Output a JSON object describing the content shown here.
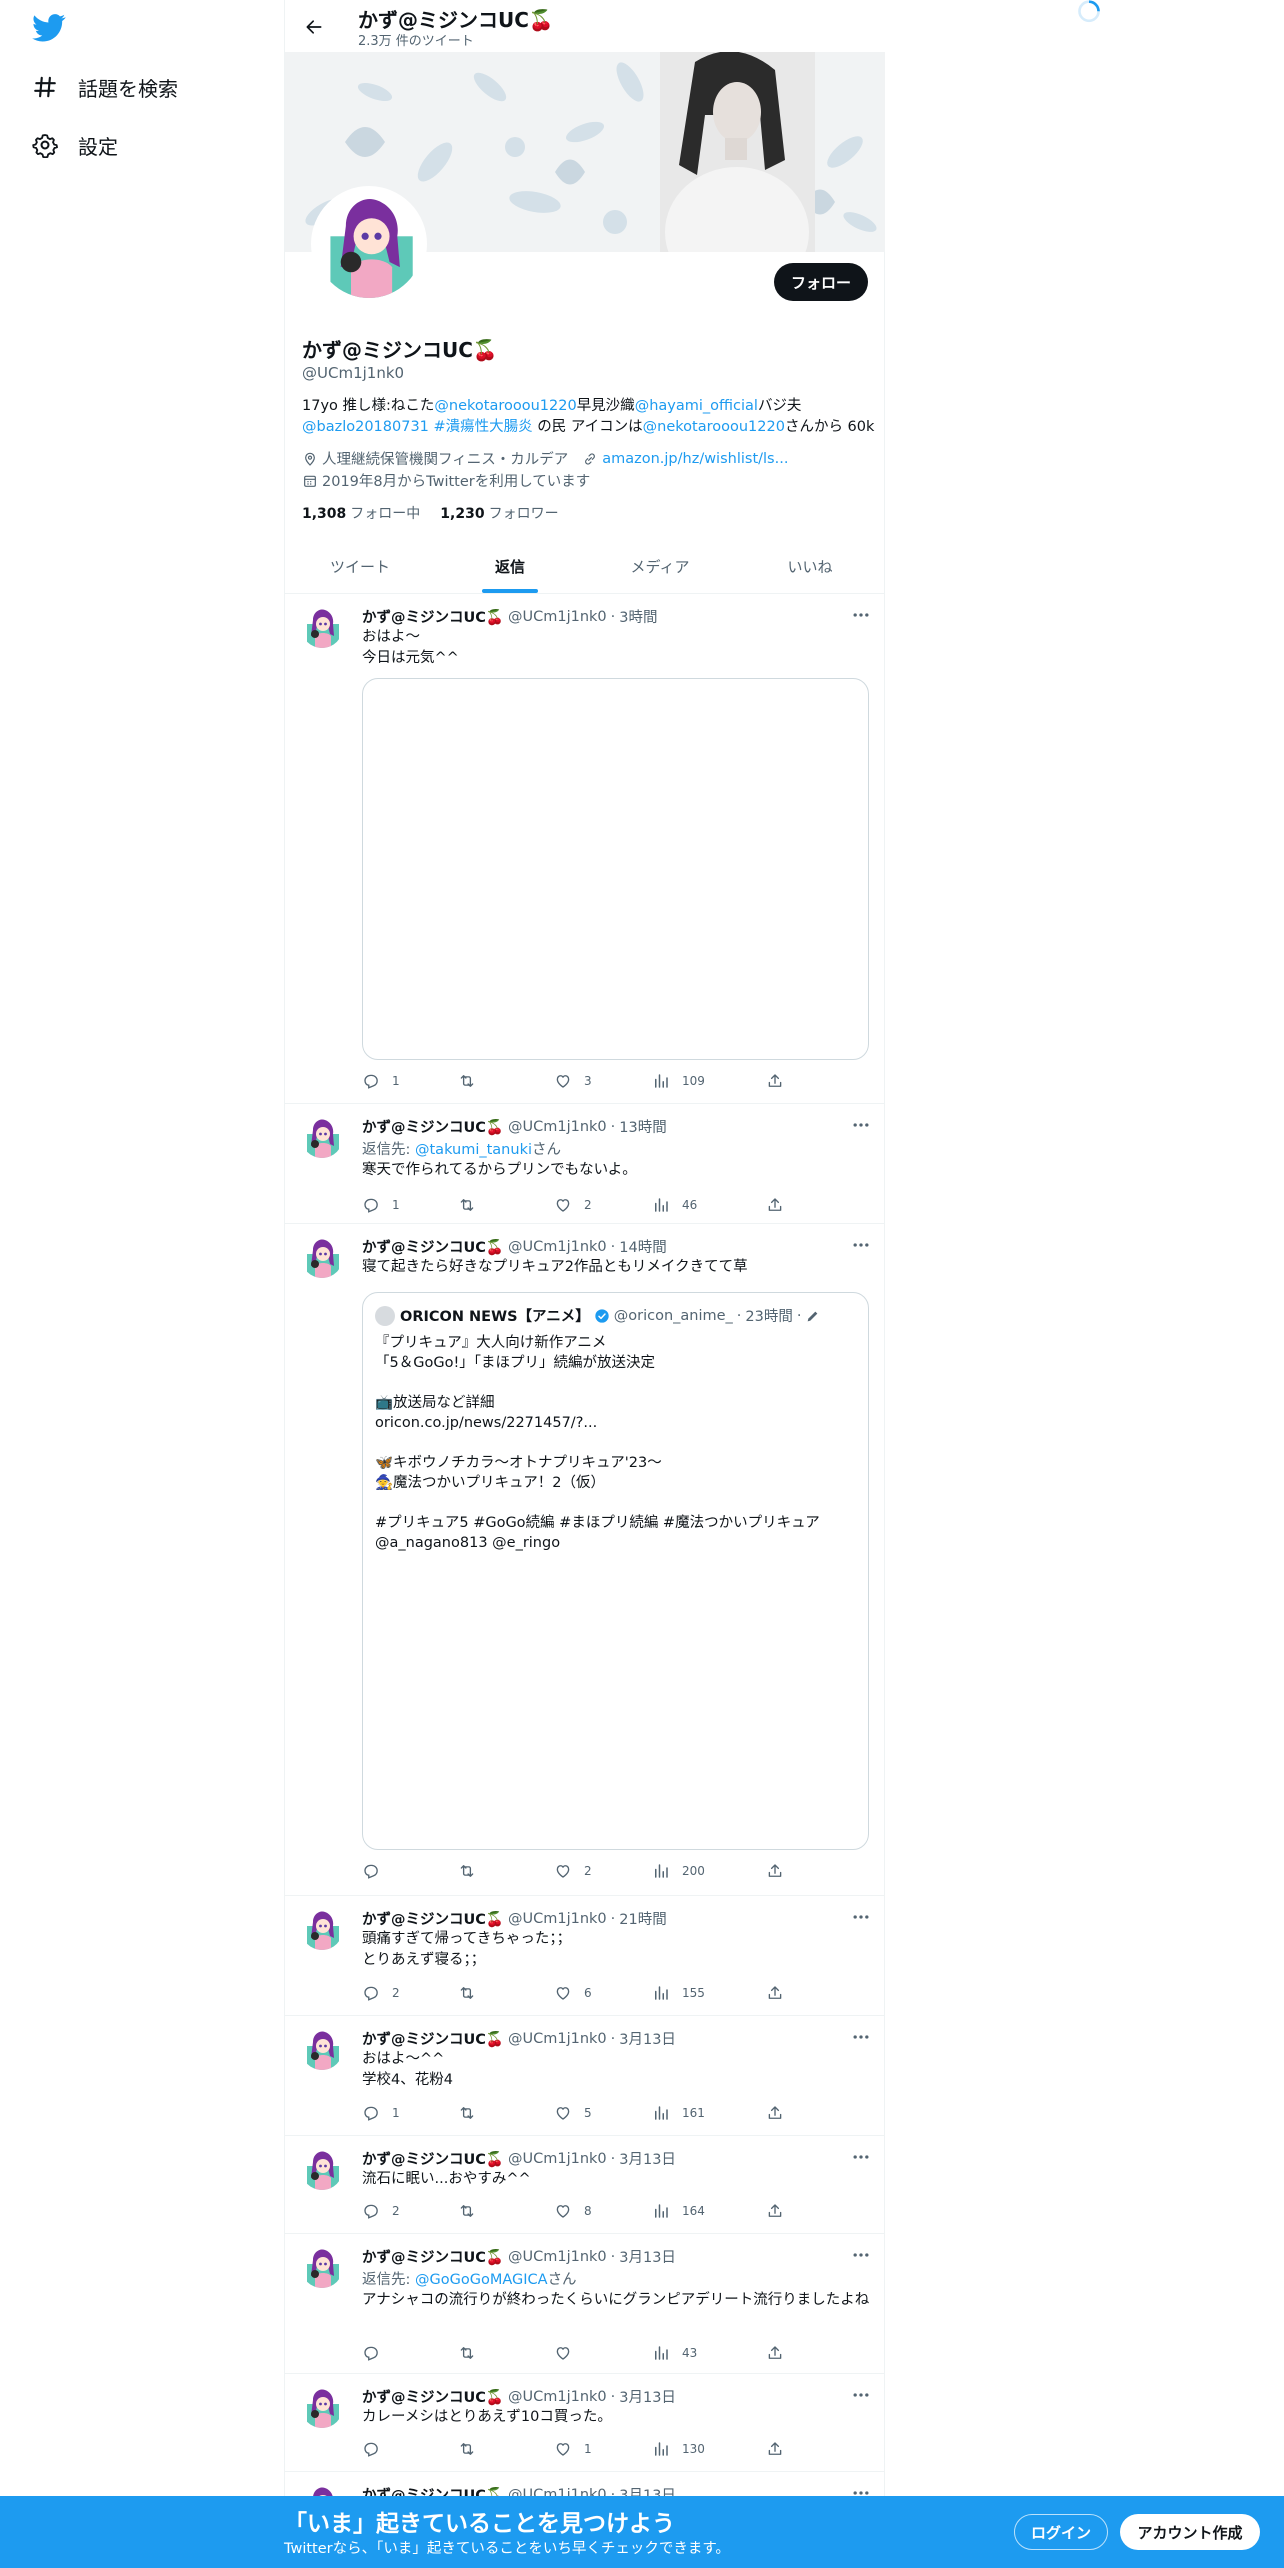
{
  "nav": {
    "explore": "話題を検索",
    "settings": "設定"
  },
  "header": {
    "name": "かず@ミジンコUC🍒",
    "tweet_count": "2.3万 件のツイート"
  },
  "profile": {
    "name": "かず@ミジンコUC🍒",
    "handle": "@UCm1j1nk0",
    "follow_label": "フォロー",
    "bio": {
      "p1": "17yo 推し様:ねこた",
      "l1": "@nekotarooou1220",
      "p2": "早見沙織",
      "l2": "@hayami_official",
      "p3": "バジ夫",
      "l3": "@bazlo20180731",
      "p4": " ",
      "l4": "#潰瘍性大腸炎",
      "p5": " の民 アイコンは",
      "l5": "@nekotarooou1220",
      "p6": "さんから 60k"
    },
    "location": "人理継続保管機関フィニス・カルデア",
    "website": "amazon.jp/hz/wishlist/ls...",
    "joined": "2019年8月からTwitterを利用しています",
    "following_count": "1,308",
    "following_label": "フォロー中",
    "followers_count": "1,230",
    "followers_label": "フォロワー"
  },
  "tabs": [
    "ツイート",
    "返信",
    "メディア",
    "いいね"
  ],
  "active_tab": "返信",
  "tweets": [
    {
      "name": "かず@ミジンコUC🍒",
      "handle": "@UCm1j1nk0",
      "time": "3時間",
      "body": "おはよ〜\n今日は元気^^",
      "reply": "1",
      "retweet": "",
      "like": "3",
      "views": "109"
    },
    {
      "name": "かず@ミジンコUC🍒",
      "handle": "@UCm1j1nk0",
      "time": "13時間",
      "reply_prefix": "返信先: ",
      "reply_to": "@takumi_tanuki",
      "reply_suffix": "さん",
      "body": "寒天で作られてるからプリンでもないよ。",
      "reply": "1",
      "retweet": "",
      "like": "2",
      "views": "46"
    },
    {
      "name": "かず@ミジンコUC🍒",
      "handle": "@UCm1j1nk0",
      "time": "14時間",
      "body": "寝て起きたら好きなプリキュア2作品ともリメイクきてて草",
      "quote": {
        "name": "ORICON NEWS【アニメ】",
        "handle": "@oricon_anime_",
        "time": "23時間",
        "body": "『プリキュア』大人向け新作アニメ\n「5＆GoGo!」「まほプリ」続編が放送決定\n\n📺放送局など詳細\noricon.co.jp/news/2271457/?...\n\n🦋キボウノチカラ～オトナプリキュア'23～\n🧙魔法つかいプリキュア！2（仮）\n\n#プリキュア5 #GoGo続編 #まほプリ続編 #魔法つかいプリキュア\n@a_nagano813 @e_ringo"
      },
      "reply": "",
      "retweet": "",
      "like": "2",
      "views": "200"
    },
    {
      "name": "かず@ミジンコUC🍒",
      "handle": "@UCm1j1nk0",
      "time": "21時間",
      "body": "頭痛すぎて帰ってきちゃった；；\nとりあえず寝る；；",
      "reply": "2",
      "retweet": "",
      "like": "6",
      "views": "155"
    },
    {
      "name": "かず@ミジンコUC🍒",
      "handle": "@UCm1j1nk0",
      "time": "3月13日",
      "body": "おはよ〜^^\n学校4、花粉4",
      "reply": "1",
      "retweet": "",
      "like": "5",
      "views": "161"
    },
    {
      "name": "かず@ミジンコUC🍒",
      "handle": "@UCm1j1nk0",
      "time": "3月13日",
      "body": "流石に眠い...おやすみ^^",
      "reply": "2",
      "retweet": "",
      "like": "8",
      "views": "164"
    },
    {
      "name": "かず@ミジンコUC🍒",
      "handle": "@UCm1j1nk0",
      "time": "3月13日",
      "reply_prefix": "返信先: ",
      "reply_to": "@GoGoGoMAGICA",
      "reply_suffix": "さん",
      "body": "アナシャコの流行りが終わったくらいにグランピアデリート流行りましたよね",
      "reply": "",
      "retweet": "",
      "like": "",
      "views": "43"
    },
    {
      "name": "かず@ミジンコUC🍒",
      "handle": "@UCm1j1nk0",
      "time": "3月13日",
      "body": "カレーメシはとりあえず10コ買った。",
      "reply": "",
      "retweet": "",
      "like": "1",
      "views": "130"
    },
    {
      "name": "かず@ミジンコUC🍒",
      "handle": "@UCm1j1nk0",
      "time": "3月13日"
    }
  ],
  "bottom_bar": {
    "title": "「いま」起きていることを見つけよう",
    "subtitle": "Twitterなら、「いま」起きていることをいち早くチェックできます。",
    "login": "ログイン",
    "signup": "アカウント作成"
  },
  "colors": {
    "accent": "#1d9bf0",
    "text": "#0f1419",
    "muted": "#536471"
  }
}
